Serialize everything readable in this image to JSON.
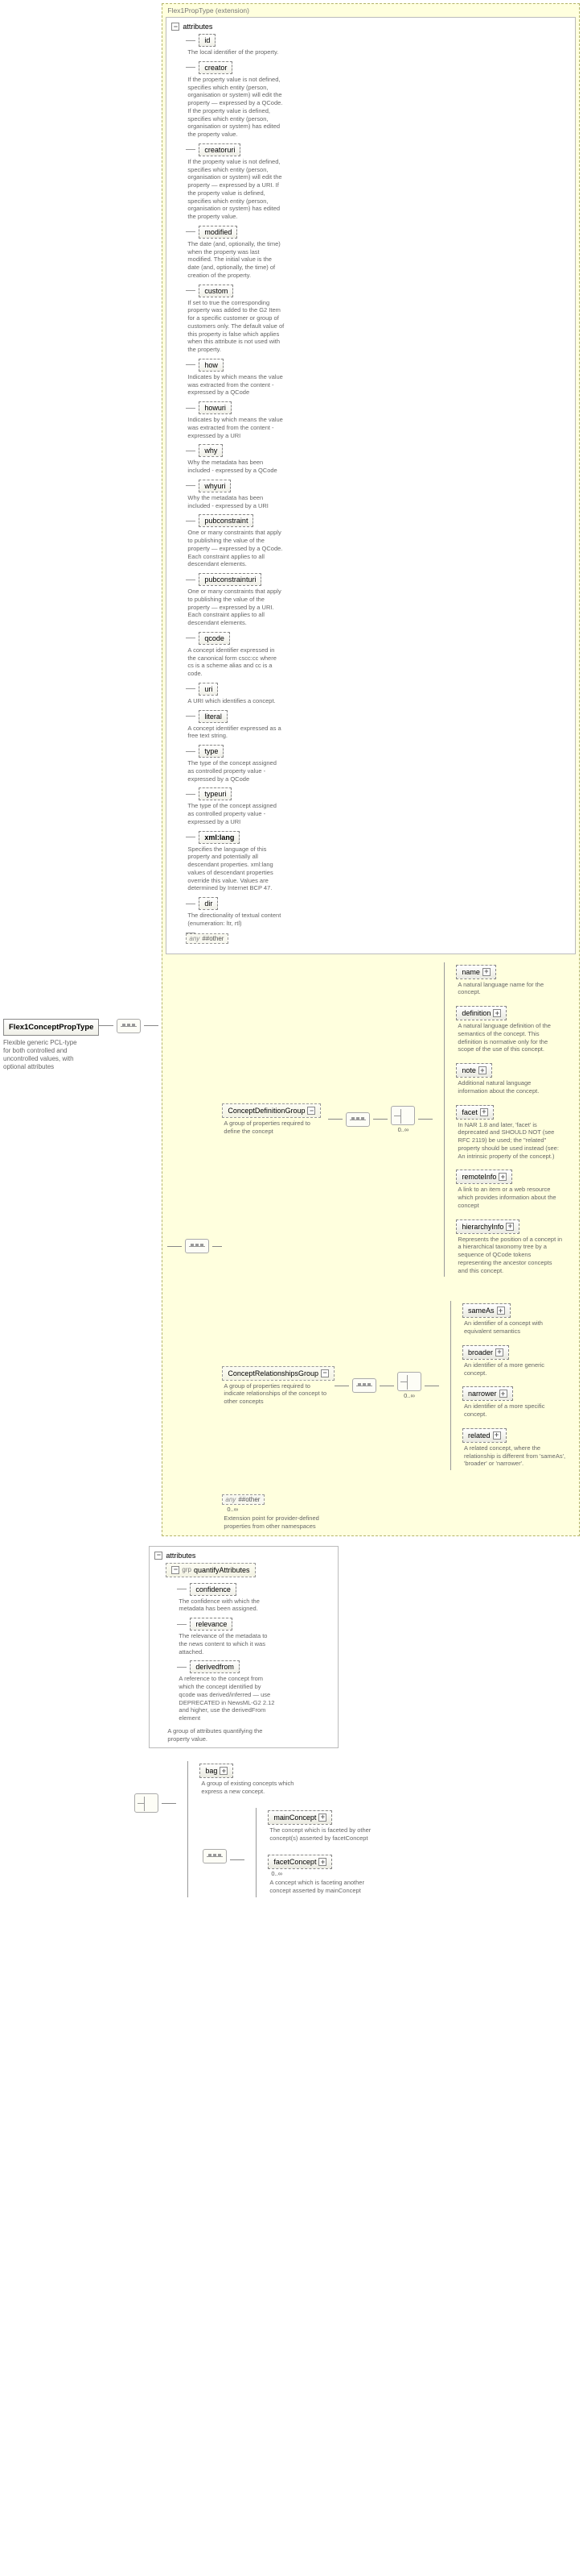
{
  "root": {
    "name": "Flex1ConceptPropType",
    "desc": "Flexible generic PCL-type for both controlled and uncontrolled values, with optional attributes"
  },
  "ext_header": "Flex1PropType (extension)",
  "attrs_label": "attributes",
  "attributes": [
    {
      "name": "id",
      "desc": "The local identifier of the property."
    },
    {
      "name": "creator",
      "desc": "If the property value is not defined, specifies which entity (person, organisation or system) will edit the property — expressed by a QCode. If the property value is defined, specifies which entity (person, organisation or system) has edited the property value."
    },
    {
      "name": "creatoruri",
      "desc": "If the property value is not defined, specifies which entity (person, organisation or system) will edit the property — expressed by a URI. If the property value is defined, specifies which entity (person, organisation or system) has edited the property value."
    },
    {
      "name": "modified",
      "desc": "The date (and, optionally, the time) when the property was last modified. The initial value is the date (and, optionally, the time) of creation of the property."
    },
    {
      "name": "custom",
      "desc": "If set to true the corresponding property was added to the G2 Item for a specific customer or group of customers only. The default value of this property is false which applies when this attribute is not used with the property."
    },
    {
      "name": "how",
      "desc": "Indicates by which means the value was extracted from the content - expressed by a QCode"
    },
    {
      "name": "howuri",
      "desc": "Indicates by which means the value was extracted from the content - expressed by a URI"
    },
    {
      "name": "why",
      "desc": "Why the metadata has been included - expressed by a QCode"
    },
    {
      "name": "whyuri",
      "desc": "Why the metadata has been included - expressed by a URI"
    },
    {
      "name": "pubconstraint",
      "desc": "One or many constraints that apply to publishing the value of the property — expressed by a QCode. Each constraint applies to all descendant elements."
    },
    {
      "name": "pubconstrainturi",
      "desc": "One or many constraints that apply to publishing the value of the property — expressed by a URI. Each constraint applies to all descendant elements."
    },
    {
      "name": "qcode",
      "desc": "A concept identifier expressed in the canonical form cscc:cc where cs is a scheme alias and cc is a code."
    },
    {
      "name": "uri",
      "desc": "A URI which identifies a concept."
    },
    {
      "name": "literal",
      "desc": "A concept identifier expressed as a free text string."
    },
    {
      "name": "type",
      "desc": "The type of the concept assigned as controlled property value - expressed by a QCode"
    },
    {
      "name": "typeuri",
      "desc": "The type of the concept assigned as controlled property value - expressed by a URI"
    },
    {
      "name": "xml:lang",
      "bold": true,
      "desc": "Specifies the language of this property and potentially all descendant properties. xml:lang values of descendant properties override this value. Values are determined by Internet BCP 47."
    },
    {
      "name": "dir",
      "desc": "The directionality of textual content (enumeration: ltr, rtl)"
    }
  ],
  "attr_any": {
    "tag": "any",
    "label": "##other"
  },
  "cdg": {
    "name": "ConceptDefinitionGroup",
    "desc": "A group of properties required to define the concept",
    "occur": "0..∞",
    "children": [
      {
        "name": "name",
        "plus": true,
        "desc": "A natural language name for the concept."
      },
      {
        "name": "definition",
        "plus": true,
        "desc": "A natural language definition of the semantics of the concept. This definition is normative only for the scope of the use of this concept."
      },
      {
        "name": "note",
        "plus": true,
        "desc": "Additional natural language information about the concept."
      },
      {
        "name": "facet",
        "plus": true,
        "desc": "In NAR 1.8 and later, 'facet' is deprecated and SHOULD NOT (see RFC 2119) be used; the \"related\" property should be used instead (see: An intrinsic property of the concept.)"
      },
      {
        "name": "remoteInfo",
        "plus": true,
        "desc": "A link to an item or a web resource which provides information about the concept"
      },
      {
        "name": "hierarchyInfo",
        "plus": true,
        "desc": "Represents the position of a concept in a hierarchical taxonomy tree by a sequence of QCode tokens representing the ancestor concepts and this concept."
      }
    ]
  },
  "crg": {
    "name": "ConceptRelationshipsGroup",
    "desc": "A group of properties required to indicate relationships of the concept to other concepts",
    "occur": "0..∞",
    "children": [
      {
        "name": "sameAs",
        "plus": true,
        "desc": "An identifier of a concept with equivalent semantics"
      },
      {
        "name": "broader",
        "plus": true,
        "desc": "An identifier of a more generic concept."
      },
      {
        "name": "narrower",
        "plus": true,
        "desc": "An identifier of a more specific concept."
      },
      {
        "name": "related",
        "plus": true,
        "desc": "A related concept, where the relationship is different from 'sameAs', 'broader' or 'narrower'."
      }
    ]
  },
  "ext_any": {
    "label": "##other",
    "occur": "0..∞",
    "desc": "Extension point for provider-defined properties from other namespaces"
  },
  "quant": {
    "box_label": "attributes",
    "group_name": "quantifyAttributes",
    "desc": "A group of attributes quantifying the property value.",
    "attrs": [
      {
        "name": "confidence",
        "desc": "The confidence with which the metadata has been assigned."
      },
      {
        "name": "relevance",
        "desc": "The relevance of the metadata to the news content to which it was attached."
      },
      {
        "name": "derivedfrom",
        "desc": "A reference to the concept from which the concept identified by qcode was derived/inferred — use DEPRECATED in NewsML-G2 2.12 and higher, use the derivedFrom element"
      }
    ]
  },
  "lower": {
    "bag": {
      "name": "bag",
      "plus": true,
      "desc": "A group of existing concepts which express a new concept."
    },
    "mainConcept": {
      "name": "mainConcept",
      "plus": true,
      "desc": "The concept which is faceted by other concept(s) asserted by facetConcept"
    },
    "facetConcept": {
      "name": "facetConcept",
      "plus": true,
      "occur": "0..∞",
      "desc": "A concept which is faceting another concept asserted by mainConcept"
    }
  }
}
